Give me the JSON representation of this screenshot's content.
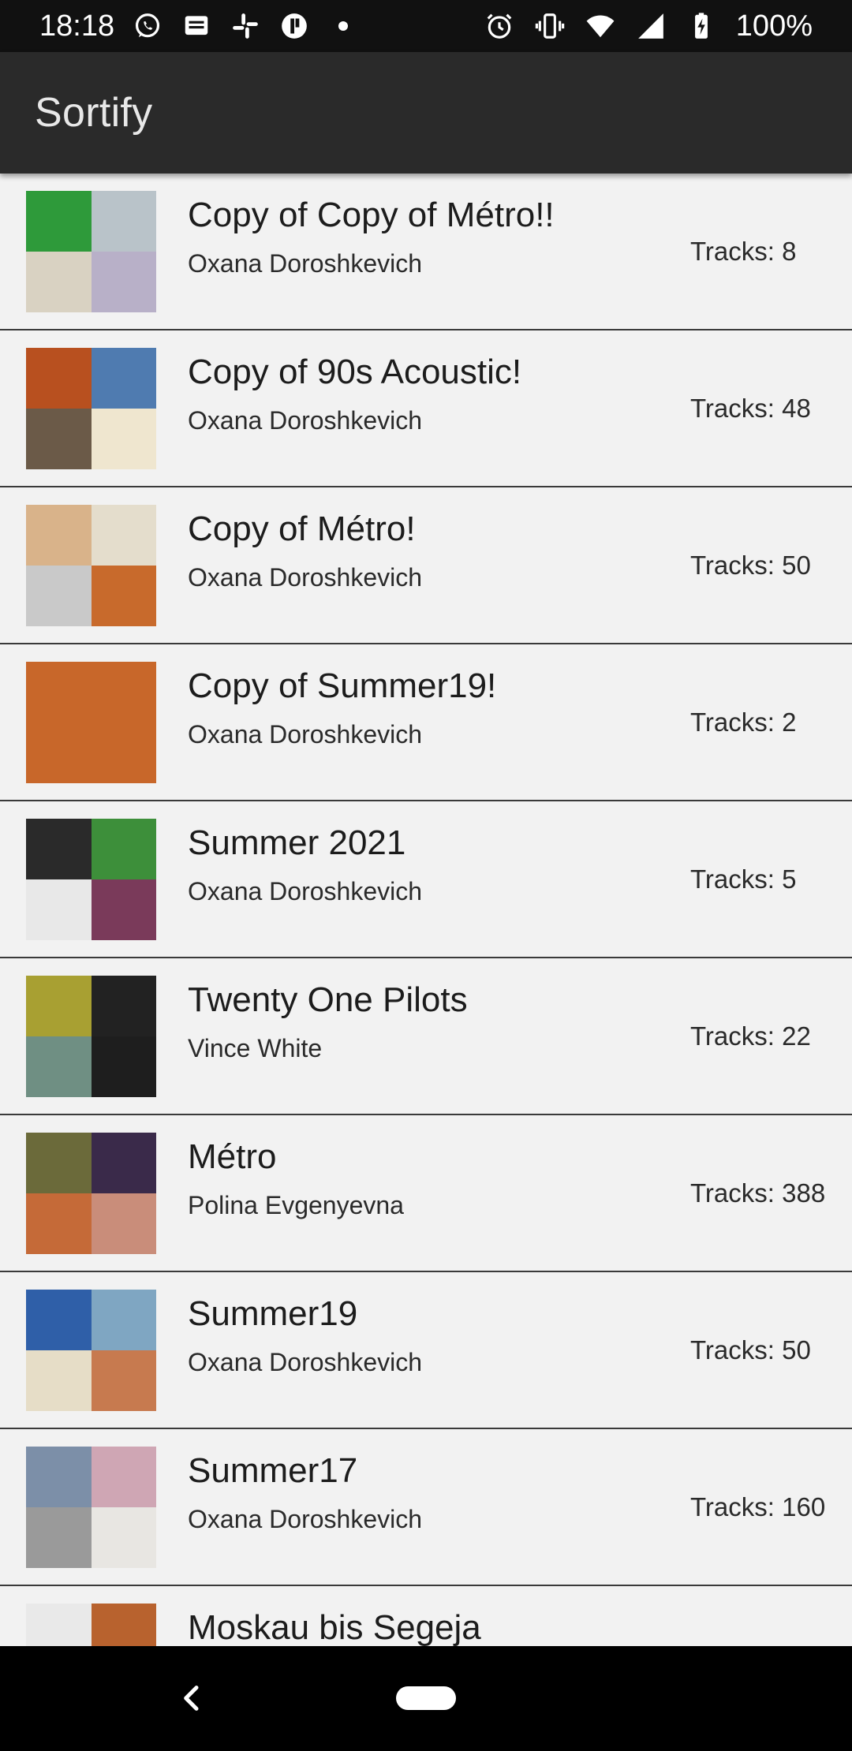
{
  "status_bar": {
    "time": "18:18",
    "left_icons": [
      "whatsapp-icon",
      "message-icon",
      "slack-icon",
      "app-icon"
    ],
    "right_icons": [
      "alarm-icon",
      "vibrate-icon",
      "wifi-icon",
      "signal-icon",
      "battery-charging-icon"
    ],
    "battery": "100%"
  },
  "app_bar": {
    "title": "Sortify"
  },
  "playlists": [
    {
      "name": "Copy of Copy of Métro!!",
      "owner": "Oxana Doroshkevich",
      "tracks": "Tracks: 8",
      "cover": [
        "#2e9a3a",
        "#b9c3c9",
        "#d9d2c2",
        "#b8b0c8"
      ]
    },
    {
      "name": "Copy of 90s Acoustic!",
      "owner": "Oxana Doroshkevich",
      "tracks": "Tracks: 48",
      "cover": [
        "#b8501f",
        "#4f7bb0",
        "#6b5a48",
        "#efe6cf"
      ]
    },
    {
      "name": "Copy of Métro!",
      "owner": "Oxana Doroshkevich",
      "tracks": "Tracks: 50",
      "cover": [
        "#d9b38a",
        "#e4ddcc",
        "#c9c9c9",
        "#c86a2c"
      ]
    },
    {
      "name": "Copy of Summer19!",
      "owner": "Oxana Doroshkevich",
      "tracks": "Tracks: 2",
      "cover": [
        "#c8672a"
      ]
    },
    {
      "name": "Summer 2021",
      "owner": "Oxana Doroshkevich",
      "tracks": "Tracks: 5",
      "cover": [
        "#2a2a2a",
        "#3d8f3a",
        "#e8e8e8",
        "#7a3a5a"
      ]
    },
    {
      "name": "Twenty One Pilots",
      "owner": "Vince White",
      "tracks": "Tracks: 22",
      "cover": [
        "#a8a032",
        "#222222",
        "#6f8f83",
        "#1e1e1e"
      ]
    },
    {
      "name": "Métro",
      "owner": "Polina Evgenyevna",
      "tracks": "Tracks: 388",
      "cover": [
        "#6b6a3a",
        "#3a2a4a",
        "#c56a38",
        "#c98d7a"
      ]
    },
    {
      "name": "Summer19",
      "owner": "Oxana Doroshkevich",
      "tracks": "Tracks: 50",
      "cover": [
        "#2f5fa8",
        "#7fa6c2",
        "#e6ddc7",
        "#c77a4f"
      ]
    },
    {
      "name": "Summer17",
      "owner": "Oxana Doroshkevich",
      "tracks": "Tracks: 160",
      "cover": [
        "#7c8fa8",
        "#cfa6b4",
        "#9a9a9a",
        "#e8e6e2"
      ]
    },
    {
      "name": "Moskau bis Segeja",
      "owner": "",
      "tracks": "",
      "cover": [
        "#e9e9e9",
        "#b8622e",
        "#2a2a2a",
        "#4a4a6a"
      ]
    }
  ],
  "nav_bar": {
    "back": "back-icon",
    "home": "home-pill"
  }
}
